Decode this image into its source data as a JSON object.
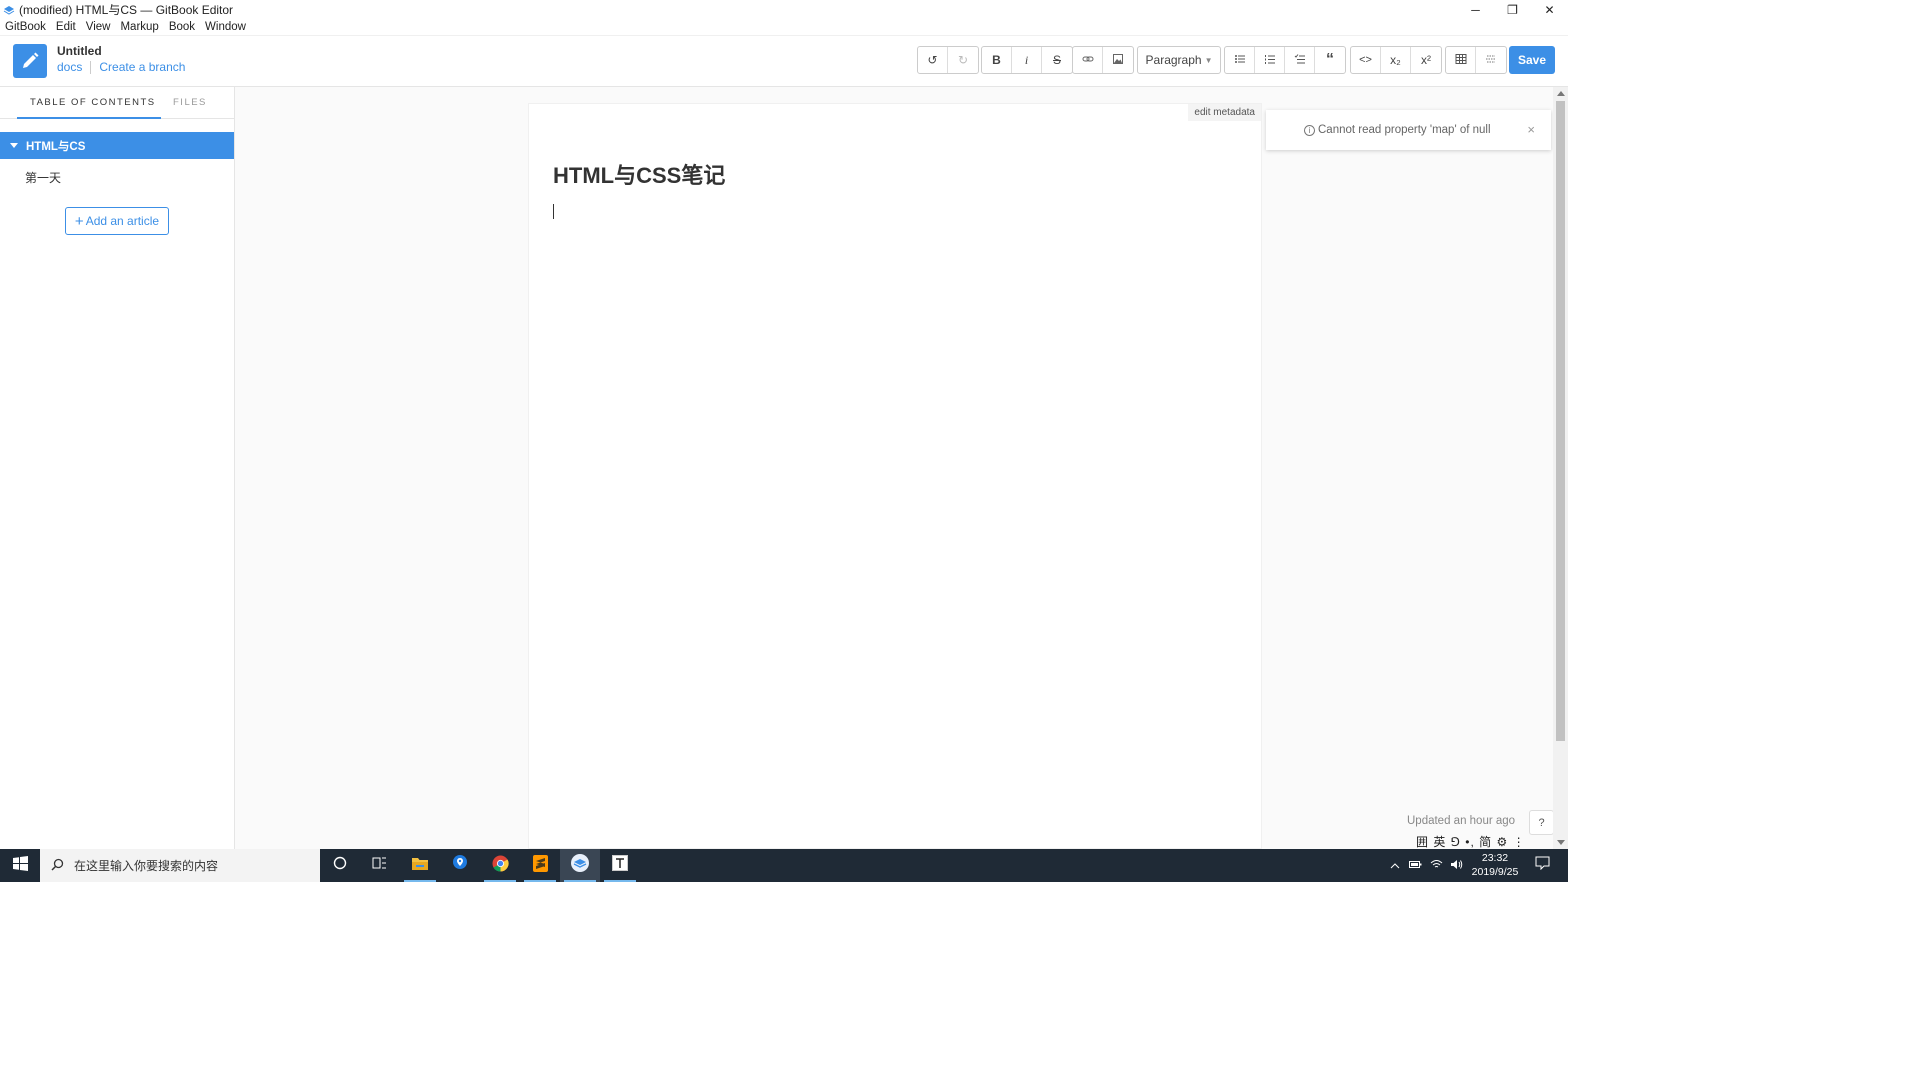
{
  "window": {
    "title": "(modified) HTML与CS — GitBook Editor",
    "minimize": "─",
    "restore": "❐",
    "close": "✕"
  },
  "menu": [
    "GitBook",
    "Edit",
    "View",
    "Markup",
    "Book",
    "Window"
  ],
  "header": {
    "book_title": "Untitled",
    "branch": "docs",
    "create_branch": "Create a branch"
  },
  "toolbar": {
    "undo": "↺",
    "redo": "↻",
    "bold": "B",
    "italic": "i",
    "strike": "S",
    "paragraph": "Paragraph",
    "subscript": "x₂",
    "superscript": "x²",
    "save": "Save"
  },
  "sidebar": {
    "tab_toc": "TABLE OF CONTENTS",
    "tab_files": "FILES",
    "toc_selected": "HTML与CS",
    "toc_items": [
      "第一天"
    ],
    "add_article": "Add an article"
  },
  "editor": {
    "edit_metadata": "edit metadata",
    "doc_title": "HTML与CSS笔记"
  },
  "toast": {
    "message": "Cannot read property 'map' of null",
    "close": "×"
  },
  "status": {
    "updated": "Updated an hour ago",
    "help": "?",
    "ime": "囲 英 ⅁ •, 简 ⚙ ⋮"
  },
  "taskbar": {
    "search_placeholder": "在这里输入你要搜索的内容",
    "time": "23:32",
    "date": "2019/9/25"
  },
  "colors": {
    "accent": "#3c8fe6",
    "taskbar": "#1f2a36"
  }
}
